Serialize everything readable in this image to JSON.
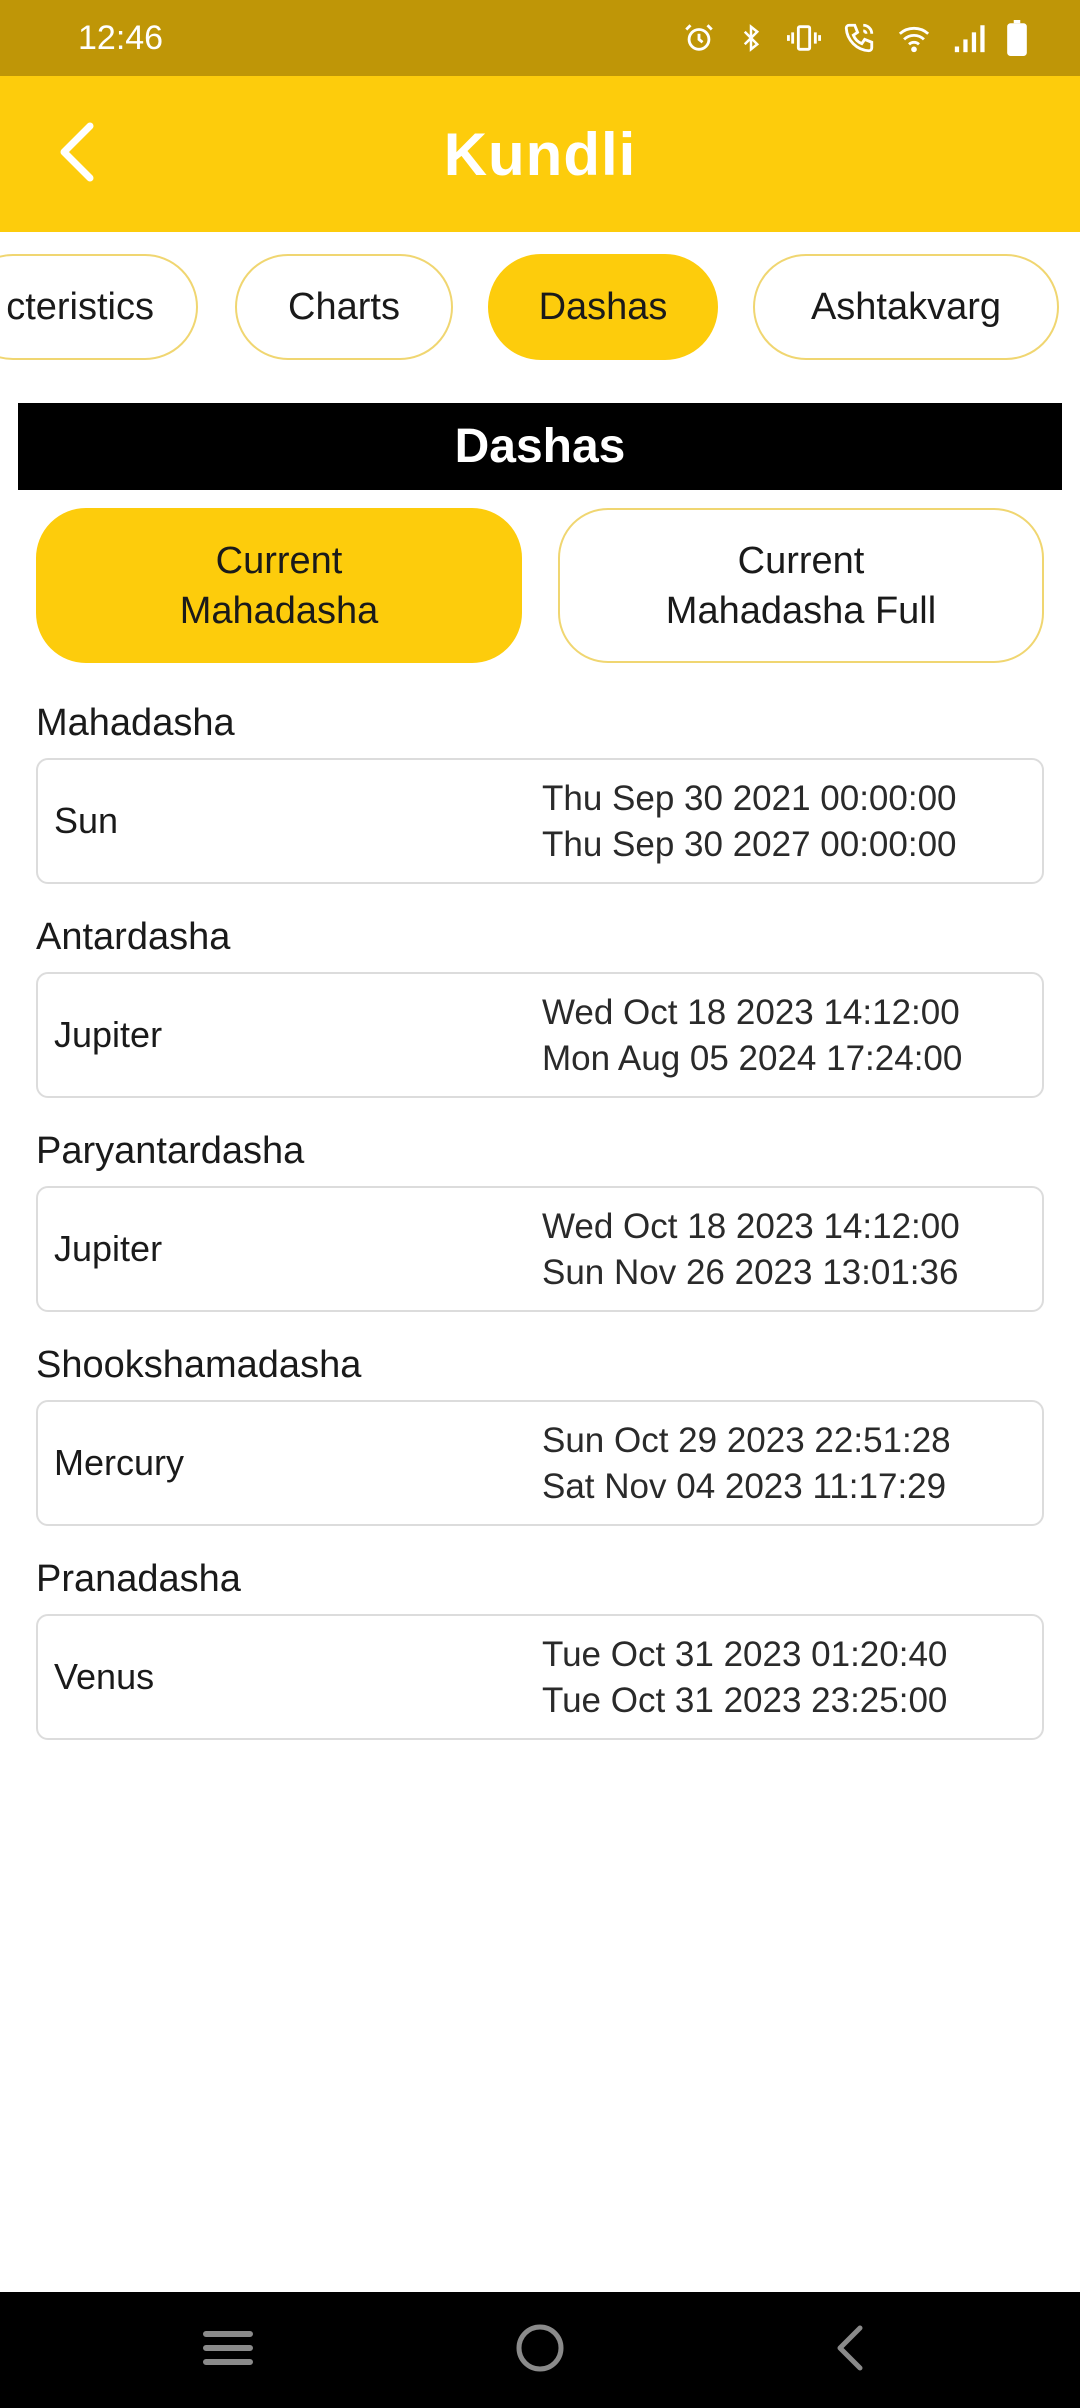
{
  "status_bar": {
    "time": "12:46",
    "icons": [
      "alarm-icon",
      "bluetooth-icon",
      "vibrate-icon",
      "wifi-calling-icon",
      "wifi-icon",
      "signal-icon",
      "battery-icon"
    ]
  },
  "app_bar": {
    "title": "Kundli",
    "back_icon": "chevron-left-icon"
  },
  "tabs": [
    {
      "label": "cteristics",
      "active": false
    },
    {
      "label": "Charts",
      "active": false
    },
    {
      "label": "Dashas",
      "active": true
    },
    {
      "label": "Ashtakvarg",
      "active": false
    }
  ],
  "section_title": "Dashas",
  "segments": [
    {
      "label": "Current\nMahadasha",
      "active": true
    },
    {
      "label": "Current\nMahadasha Full",
      "active": false
    }
  ],
  "dashas": [
    {
      "label": "Mahadasha",
      "planet": "Sun",
      "start": "Thu Sep 30 2021 00:00:00",
      "end": "Thu Sep 30 2027 00:00:00"
    },
    {
      "label": "Antardasha",
      "planet": "Jupiter",
      "start": "Wed Oct 18 2023 14:12:00",
      "end": "Mon Aug 05 2024 17:24:00"
    },
    {
      "label": "Paryantardasha",
      "planet": "Jupiter",
      "start": "Wed Oct 18 2023 14:12:00",
      "end": "Sun Nov 26 2023 13:01:36"
    },
    {
      "label": "Shookshamadasha",
      "planet": "Mercury",
      "start": "Sun Oct 29 2023 22:51:28",
      "end": "Sat Nov 04 2023 11:17:29"
    },
    {
      "label": "Pranadasha",
      "planet": "Venus",
      "start": "Tue Oct 31 2023 01:20:40",
      "end": "Tue Oct 31 2023 23:25:00"
    }
  ],
  "nav_bar": {
    "icons": [
      "menu-icon",
      "home-icon",
      "back-icon"
    ]
  },
  "colors": {
    "accent": "#fdcc0c",
    "status_bar": "#bf9607",
    "header_bg": "#000000",
    "tab_border": "#f0d671"
  }
}
